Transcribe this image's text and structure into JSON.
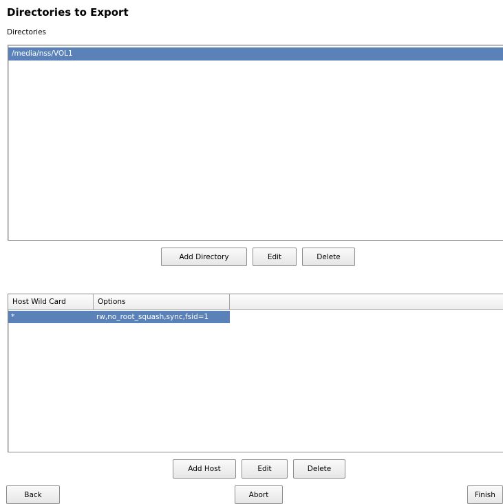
{
  "header": {
    "title": "Directories to Export"
  },
  "directories": {
    "label": "Directories",
    "items": [
      "/media/nss/VOL1"
    ],
    "add_label": "Add Directory",
    "edit_label": "Edit",
    "delete_label": "Delete"
  },
  "hosts": {
    "columns": [
      "Host Wild Card",
      "Options"
    ],
    "rows": [
      {
        "host": "*",
        "options": "rw,no_root_squash,sync,fsid=1"
      }
    ],
    "add_label": "Add Host",
    "edit_label": "Edit",
    "delete_label": "Delete"
  },
  "footer": {
    "back_label": "Back",
    "abort_label": "Abort",
    "finish_label": "Finish"
  },
  "colors": {
    "selection": "#5b82b8"
  }
}
